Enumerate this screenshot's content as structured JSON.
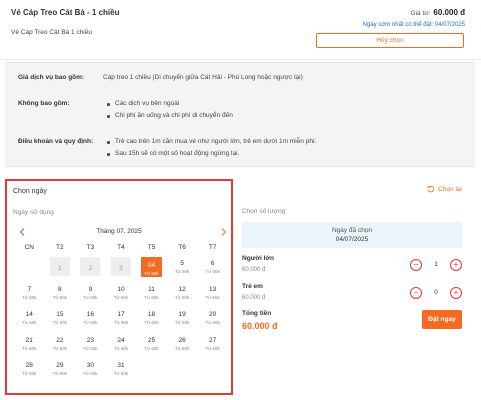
{
  "header": {
    "title": "Vé Cáp Treo Cát Bà - 1 chiều",
    "subtitle": "Vé Cáp Treo Cát Bà 1 chiều",
    "price_prefix": "Giá từ:",
    "price": "60.000 đ",
    "earliest": "Ngày sớm nhất có thể đặt: 04/07/2025",
    "cancel_label": "Hủy chọn"
  },
  "info": {
    "included_label": "Giá dịch vụ bao gồm:",
    "included_value": "Cáp treo 1 chiều (Di chuyển giữa Cát Hải - Phù Long hoặc ngược lại)",
    "excluded_label": "Không bao gồm:",
    "excluded_items": [
      "Các dịch vụ bên ngoài",
      "Chi phí ăn uống và chi phí di chuyển đến"
    ],
    "terms_label": "Điều khoản và quy định:",
    "terms_items": [
      "Trẻ cao trên 1m cần mua vé như người lớn, trẻ em dưới 1m miễn phí.",
      "Sau 15h sẽ có một số hoạt động ngừng lại."
    ]
  },
  "calendar": {
    "choose_label": "Chọn ngày",
    "use_date_label": "Ngày sử dụng",
    "month_label": "Tháng 07, 2025",
    "weekdays": [
      "CN",
      "T2",
      "T3",
      "T4",
      "T5",
      "T6",
      "T7"
    ],
    "price_label": "Từ 60k",
    "days": [
      {
        "n": "1",
        "state": "disabled"
      },
      {
        "n": "2",
        "state": "disabled"
      },
      {
        "n": "3",
        "state": "disabled"
      },
      {
        "n": "04",
        "state": "selected"
      },
      {
        "n": "5",
        "state": "available"
      },
      {
        "n": "6",
        "state": "available"
      },
      {
        "n": "7",
        "state": "available"
      },
      {
        "n": "8",
        "state": "available"
      },
      {
        "n": "9",
        "state": "available"
      },
      {
        "n": "10",
        "state": "available"
      },
      {
        "n": "11",
        "state": "available"
      },
      {
        "n": "12",
        "state": "available"
      },
      {
        "n": "13",
        "state": "available"
      },
      {
        "n": "14",
        "state": "available"
      },
      {
        "n": "15",
        "state": "available"
      },
      {
        "n": "16",
        "state": "available"
      },
      {
        "n": "17",
        "state": "available"
      },
      {
        "n": "18",
        "state": "available"
      },
      {
        "n": "19",
        "state": "available"
      },
      {
        "n": "20",
        "state": "available"
      },
      {
        "n": "21",
        "state": "available"
      },
      {
        "n": "22",
        "state": "available"
      },
      {
        "n": "23",
        "state": "available"
      },
      {
        "n": "24",
        "state": "available"
      },
      {
        "n": "25",
        "state": "available"
      },
      {
        "n": "26",
        "state": "available"
      },
      {
        "n": "27",
        "state": "available"
      },
      {
        "n": "28",
        "state": "available"
      },
      {
        "n": "29",
        "state": "available"
      },
      {
        "n": "30",
        "state": "available"
      },
      {
        "n": "31",
        "state": "available"
      }
    ]
  },
  "booking": {
    "redo_label": "Chọn lại",
    "qty_title": "Chọn số lượng",
    "chosen_label": "Ngày đã chọn",
    "chosen_date": "04/07/2025",
    "adult_label": "Người lớn",
    "adult_price": "60.000 đ",
    "adult_qty": "1",
    "child_label": "Trẻ em",
    "child_price": "60.000 đ",
    "child_qty": "0",
    "total_label": "Tổng tiền",
    "total_value": "60.000 đ",
    "book_label": "Đặt ngay"
  },
  "colors": {
    "accent": "#f26b21",
    "highlight_border": "#e53935",
    "link": "#1e6bd6"
  }
}
